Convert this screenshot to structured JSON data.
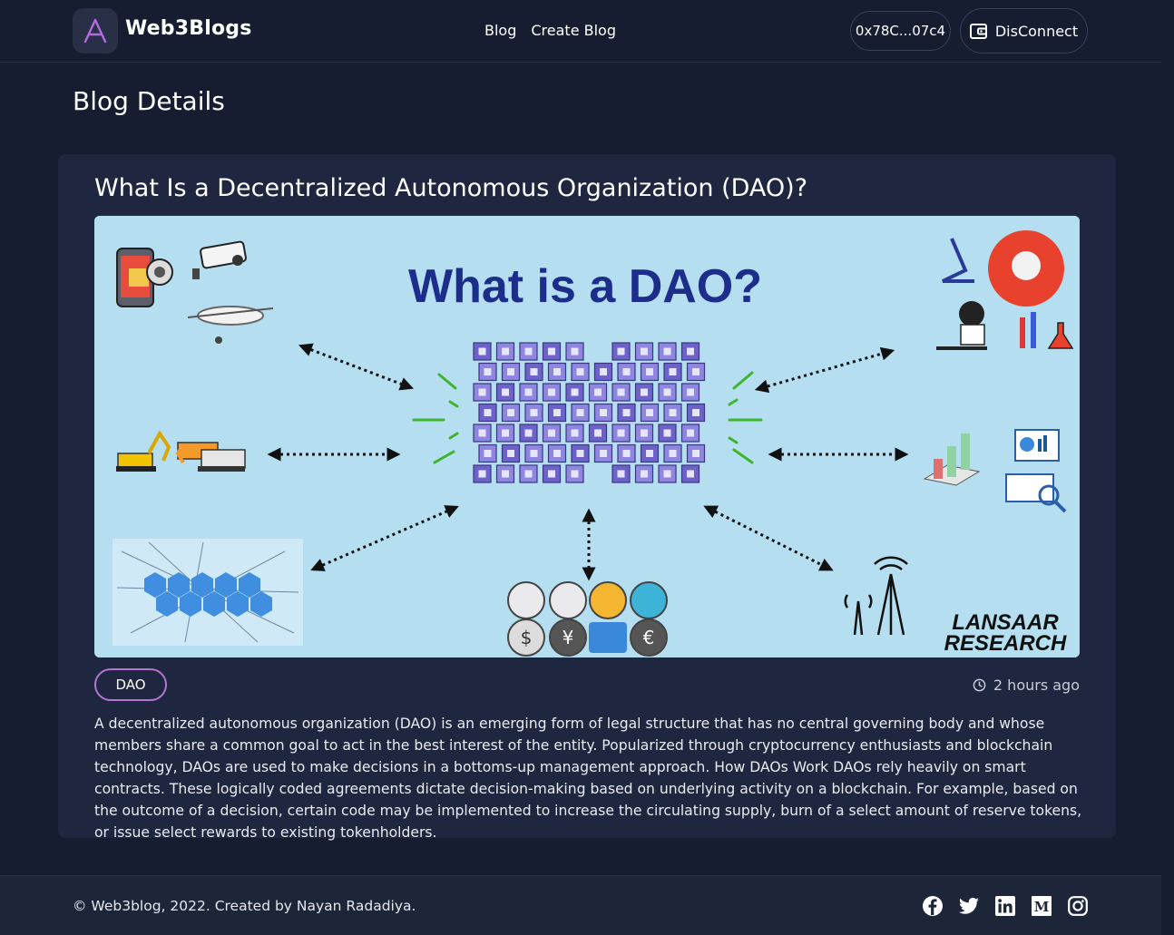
{
  "header": {
    "brand": "Web3Blogs",
    "nav": [
      {
        "label": "Blog"
      },
      {
        "label": "Create Blog"
      }
    ],
    "wallet_address": "0x78C...07c4",
    "disconnect_label": "DisConnect"
  },
  "page": {
    "title": "Blog Details"
  },
  "post": {
    "title": "What Is a Decentralized Autonomous Organization (DAO)?",
    "image": {
      "headline": "What is a DAO?",
      "brand_line1": "LANSAAR",
      "brand_line2": "RESEARCH"
    },
    "tag": "DAO",
    "time_ago": "2 hours ago",
    "body": "A decentralized autonomous organization (DAO) is an emerging form of legal structure that has no central governing body and whose members share a common goal to act in the best interest of the entity. Popularized through cryptocurrency enthusiasts and blockchain technology, DAOs are used to make decisions in a bottoms-up management approach. How DAOs Work DAOs rely heavily on smart contracts. These logically coded agreements dictate decision-making based on underlying activity on a blockchain. For example, based on the outcome of a decision, certain code may be implemented to increase the circulating supply, burn of a select amount of reserve tokens, or issue select rewards to existing tokenholders."
  },
  "footer": {
    "copyright": "© Web3blog, 2022. Created by Nayan Radadiya.",
    "social_icons": [
      "facebook-icon",
      "twitter-icon",
      "linkedin-icon",
      "medium-icon",
      "instagram-icon"
    ]
  },
  "colors": {
    "background": "#161d31",
    "card": "#1f2740",
    "tag_border": "#b277d3",
    "image_bg": "#b5dff0",
    "headline": "#1c2d8c"
  }
}
